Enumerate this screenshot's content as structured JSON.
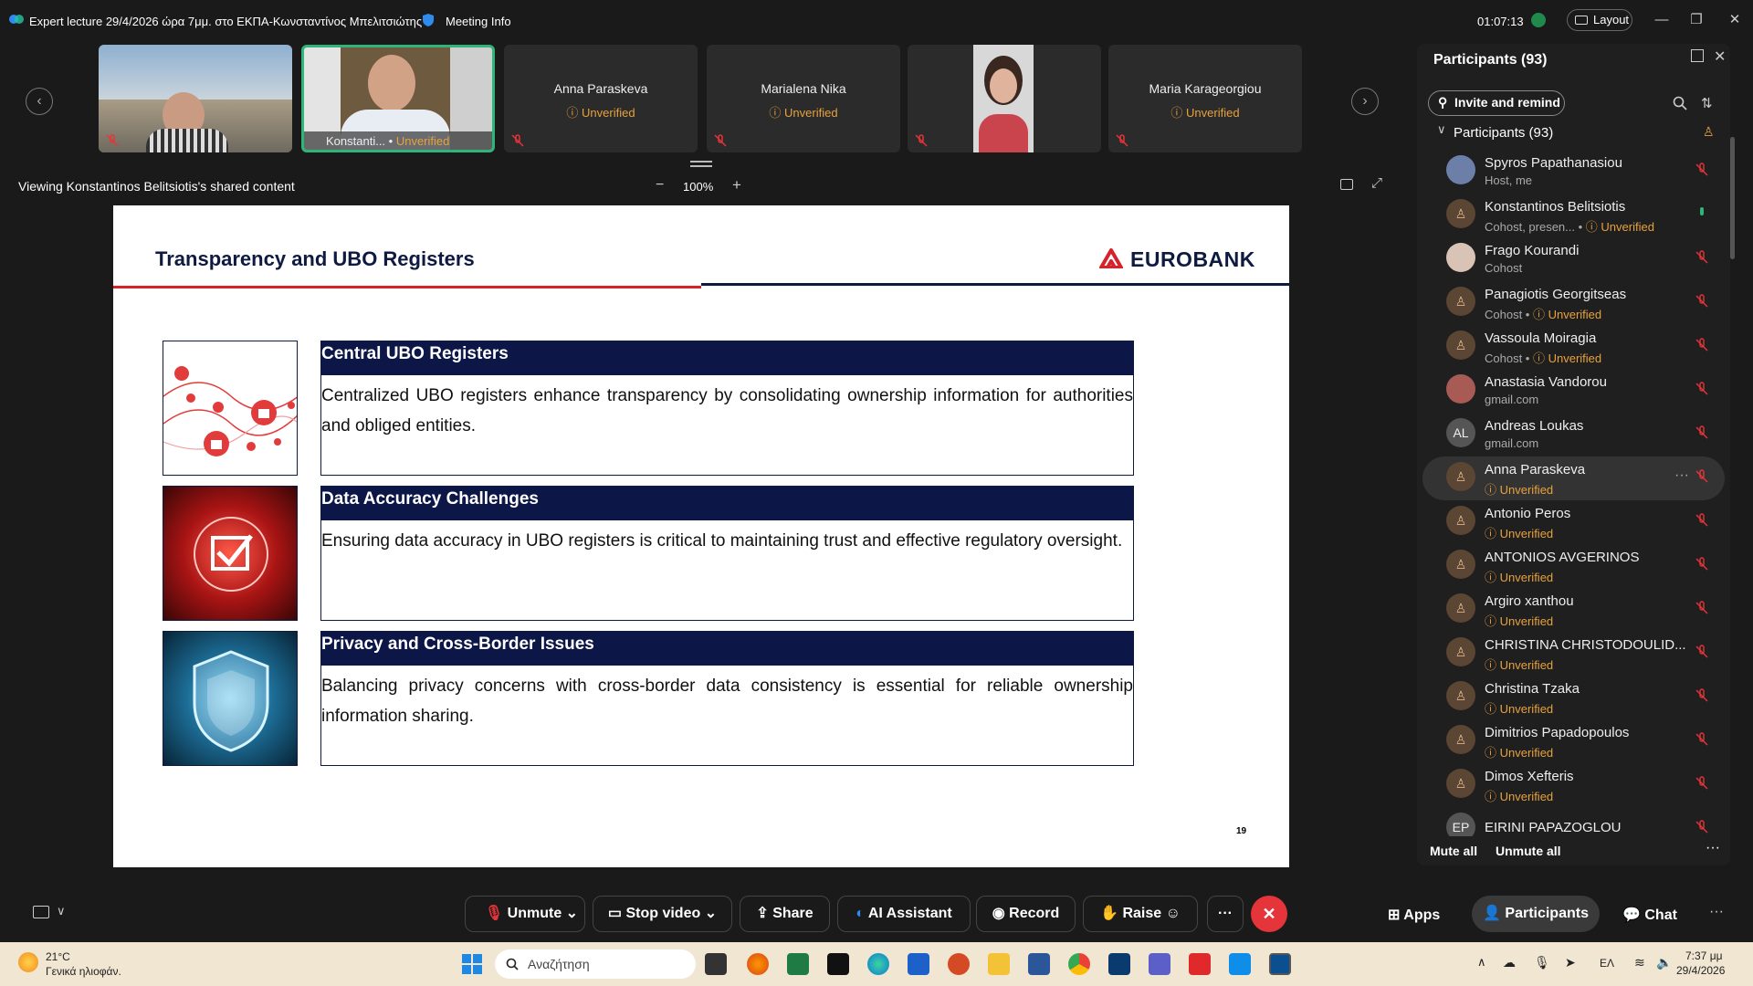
{
  "window": {
    "title": "Expert lecture 29/4/2026 ώρα 7μμ. στο ΕΚΠΑ-Κωνσταντίνος Μπελιτσιώτης",
    "meeting_info": "Meeting Info",
    "timer": "01:07:13",
    "layout": "Layout"
  },
  "gallery": {
    "tiles": [
      {
        "name": "",
        "unverified": ""
      },
      {
        "name": "Konstanti...",
        "unverified": "Unverified"
      },
      {
        "name": "Anna Paraskeva",
        "unverified": "Unverified"
      },
      {
        "name": "Marialena Nika",
        "unverified": "Unverified"
      },
      {
        "name": "",
        "unverified": ""
      },
      {
        "name": "Maria Karageorgiou",
        "unverified": "Unverified"
      }
    ]
  },
  "share": {
    "viewing": "Viewing Konstantinos Belitsiotis's shared content",
    "zoom": "100%",
    "minus": "−",
    "plus": "+"
  },
  "slide": {
    "title": "Transparency and UBO Registers",
    "logo": "EUROBANK",
    "page": "19",
    "cards": [
      {
        "heading": "Central UBO Registers",
        "body": "Centralized UBO registers enhance transparency by consolidating ownership information for authorities and obliged entities."
      },
      {
        "heading": "Data Accuracy Challenges",
        "body": "Ensuring data accuracy in UBO registers is critical to maintaining trust and effective regulatory oversight."
      },
      {
        "heading": "Privacy and Cross-Border Issues",
        "body": "Balancing privacy concerns with cross-border data consistency is essential for reliable ownership information sharing."
      }
    ]
  },
  "participants": {
    "title": "Participants (93)",
    "invite": "Invite and remind",
    "group": "Participants (93)",
    "mute_all": "Mute all",
    "unmute_all": "Unmute all",
    "list": [
      {
        "name": "Spyros Papathanasiou",
        "sub": "Host, me",
        "unv": "",
        "initials": ""
      },
      {
        "name": "Konstantinos Belitsiotis",
        "sub": "Cohost, presen... •",
        "unv": "Unverified",
        "initials": ""
      },
      {
        "name": "Frago Kourandi",
        "sub": "Cohost",
        "unv": "",
        "initials": ""
      },
      {
        "name": "Panagiotis Georgitseas",
        "sub": "Cohost •",
        "unv": "Unverified",
        "initials": ""
      },
      {
        "name": "Vassoula Moiragia",
        "sub": "Cohost •",
        "unv": "Unverified",
        "initials": ""
      },
      {
        "name": "Anastasia Vandorou",
        "sub": "gmail.com",
        "unv": "",
        "initials": ""
      },
      {
        "name": "Andreas Loukas",
        "sub": "gmail.com",
        "unv": "",
        "initials": "AL"
      },
      {
        "name": "Anna Paraskeva",
        "sub": "",
        "unv": "Unverified",
        "initials": ""
      },
      {
        "name": "Antonio Peros",
        "sub": "",
        "unv": "Unverified",
        "initials": ""
      },
      {
        "name": "ANTONIOS AVGERINOS",
        "sub": "",
        "unv": "Unverified",
        "initials": ""
      },
      {
        "name": "Argiro xanthou",
        "sub": "",
        "unv": "Unverified",
        "initials": ""
      },
      {
        "name": "CHRISTINA CHRISTODOULID...",
        "sub": "",
        "unv": "Unverified",
        "initials": ""
      },
      {
        "name": "Christina Tzaka",
        "sub": "",
        "unv": "Unverified",
        "initials": ""
      },
      {
        "name": "Dimitrios Papadopoulos",
        "sub": "",
        "unv": "Unverified",
        "initials": ""
      },
      {
        "name": "Dimos Xefteris",
        "sub": "",
        "unv": "Unverified",
        "initials": ""
      },
      {
        "name": "EIRINI PAPAZOGLOU",
        "sub": "",
        "unv": "",
        "initials": "EP"
      }
    ]
  },
  "controls": {
    "unmute": "Unmute",
    "stop_video": "Stop video",
    "share": "Share",
    "ai": "AI Assistant",
    "record": "Record",
    "raise": "Raise",
    "more": "···",
    "apps": "Apps",
    "participants": "Participants",
    "chat": "Chat"
  },
  "taskbar": {
    "temp": "21°C",
    "weather": "Γενικά ηλιοφάν.",
    "search": "Αναζήτηση",
    "lang": "ΕΛ",
    "time": "7:37 μμ",
    "date": "29/4/2026"
  },
  "colors": {
    "navy": "#0c1647",
    "red": "#d6222a",
    "unverified": "#e6a23c",
    "end": "#e5343a"
  }
}
